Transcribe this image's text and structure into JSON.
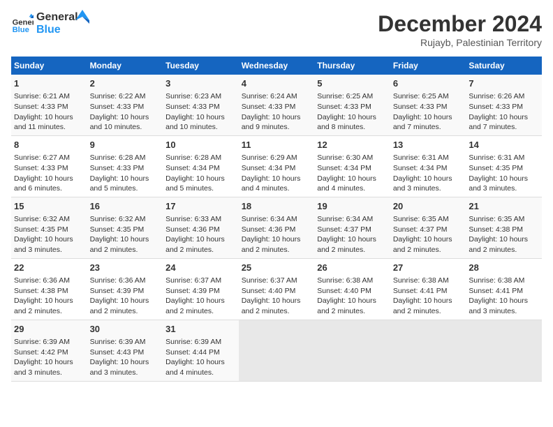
{
  "header": {
    "logo_line1": "General",
    "logo_line2": "Blue",
    "main_title": "December 2024",
    "subtitle": "Rujayb, Palestinian Territory"
  },
  "days_of_week": [
    "Sunday",
    "Monday",
    "Tuesday",
    "Wednesday",
    "Thursday",
    "Friday",
    "Saturday"
  ],
  "weeks": [
    [
      {
        "day": "1",
        "sunrise": "6:21 AM",
        "sunset": "4:33 PM",
        "daylight": "10 hours and 11 minutes."
      },
      {
        "day": "2",
        "sunrise": "6:22 AM",
        "sunset": "4:33 PM",
        "daylight": "10 hours and 10 minutes."
      },
      {
        "day": "3",
        "sunrise": "6:23 AM",
        "sunset": "4:33 PM",
        "daylight": "10 hours and 10 minutes."
      },
      {
        "day": "4",
        "sunrise": "6:24 AM",
        "sunset": "4:33 PM",
        "daylight": "10 hours and 9 minutes."
      },
      {
        "day": "5",
        "sunrise": "6:25 AM",
        "sunset": "4:33 PM",
        "daylight": "10 hours and 8 minutes."
      },
      {
        "day": "6",
        "sunrise": "6:25 AM",
        "sunset": "4:33 PM",
        "daylight": "10 hours and 7 minutes."
      },
      {
        "day": "7",
        "sunrise": "6:26 AM",
        "sunset": "4:33 PM",
        "daylight": "10 hours and 7 minutes."
      }
    ],
    [
      {
        "day": "8",
        "sunrise": "6:27 AM",
        "sunset": "4:33 PM",
        "daylight": "10 hours and 6 minutes."
      },
      {
        "day": "9",
        "sunrise": "6:28 AM",
        "sunset": "4:33 PM",
        "daylight": "10 hours and 5 minutes."
      },
      {
        "day": "10",
        "sunrise": "6:28 AM",
        "sunset": "4:34 PM",
        "daylight": "10 hours and 5 minutes."
      },
      {
        "day": "11",
        "sunrise": "6:29 AM",
        "sunset": "4:34 PM",
        "daylight": "10 hours and 4 minutes."
      },
      {
        "day": "12",
        "sunrise": "6:30 AM",
        "sunset": "4:34 PM",
        "daylight": "10 hours and 4 minutes."
      },
      {
        "day": "13",
        "sunrise": "6:31 AM",
        "sunset": "4:34 PM",
        "daylight": "10 hours and 3 minutes."
      },
      {
        "day": "14",
        "sunrise": "6:31 AM",
        "sunset": "4:35 PM",
        "daylight": "10 hours and 3 minutes."
      }
    ],
    [
      {
        "day": "15",
        "sunrise": "6:32 AM",
        "sunset": "4:35 PM",
        "daylight": "10 hours and 3 minutes."
      },
      {
        "day": "16",
        "sunrise": "6:32 AM",
        "sunset": "4:35 PM",
        "daylight": "10 hours and 2 minutes."
      },
      {
        "day": "17",
        "sunrise": "6:33 AM",
        "sunset": "4:36 PM",
        "daylight": "10 hours and 2 minutes."
      },
      {
        "day": "18",
        "sunrise": "6:34 AM",
        "sunset": "4:36 PM",
        "daylight": "10 hours and 2 minutes."
      },
      {
        "day": "19",
        "sunrise": "6:34 AM",
        "sunset": "4:37 PM",
        "daylight": "10 hours and 2 minutes."
      },
      {
        "day": "20",
        "sunrise": "6:35 AM",
        "sunset": "4:37 PM",
        "daylight": "10 hours and 2 minutes."
      },
      {
        "day": "21",
        "sunrise": "6:35 AM",
        "sunset": "4:38 PM",
        "daylight": "10 hours and 2 minutes."
      }
    ],
    [
      {
        "day": "22",
        "sunrise": "6:36 AM",
        "sunset": "4:38 PM",
        "daylight": "10 hours and 2 minutes."
      },
      {
        "day": "23",
        "sunrise": "6:36 AM",
        "sunset": "4:39 PM",
        "daylight": "10 hours and 2 minutes."
      },
      {
        "day": "24",
        "sunrise": "6:37 AM",
        "sunset": "4:39 PM",
        "daylight": "10 hours and 2 minutes."
      },
      {
        "day": "25",
        "sunrise": "6:37 AM",
        "sunset": "4:40 PM",
        "daylight": "10 hours and 2 minutes."
      },
      {
        "day": "26",
        "sunrise": "6:38 AM",
        "sunset": "4:40 PM",
        "daylight": "10 hours and 2 minutes."
      },
      {
        "day": "27",
        "sunrise": "6:38 AM",
        "sunset": "4:41 PM",
        "daylight": "10 hours and 2 minutes."
      },
      {
        "day": "28",
        "sunrise": "6:38 AM",
        "sunset": "4:41 PM",
        "daylight": "10 hours and 3 minutes."
      }
    ],
    [
      {
        "day": "29",
        "sunrise": "6:39 AM",
        "sunset": "4:42 PM",
        "daylight": "10 hours and 3 minutes."
      },
      {
        "day": "30",
        "sunrise": "6:39 AM",
        "sunset": "4:43 PM",
        "daylight": "10 hours and 3 minutes."
      },
      {
        "day": "31",
        "sunrise": "6:39 AM",
        "sunset": "4:44 PM",
        "daylight": "10 hours and 4 minutes."
      },
      null,
      null,
      null,
      null
    ]
  ]
}
